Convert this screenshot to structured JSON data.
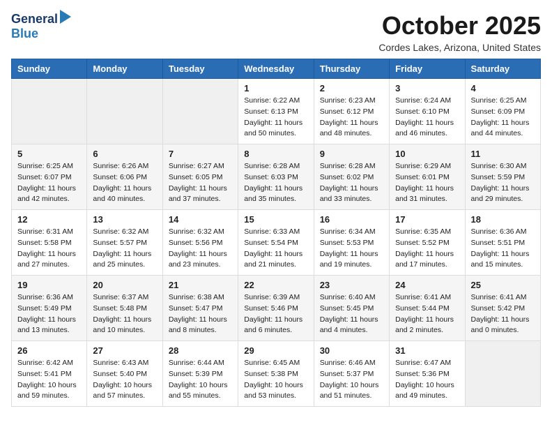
{
  "logo": {
    "line1": "General",
    "line2": "Blue"
  },
  "title": "October 2025",
  "subtitle": "Cordes Lakes, Arizona, United States",
  "weekdays": [
    "Sunday",
    "Monday",
    "Tuesday",
    "Wednesday",
    "Thursday",
    "Friday",
    "Saturday"
  ],
  "rows": [
    [
      {
        "day": "",
        "info": ""
      },
      {
        "day": "",
        "info": ""
      },
      {
        "day": "",
        "info": ""
      },
      {
        "day": "1",
        "info": "Sunrise: 6:22 AM\nSunset: 6:13 PM\nDaylight: 11 hours\nand 50 minutes."
      },
      {
        "day": "2",
        "info": "Sunrise: 6:23 AM\nSunset: 6:12 PM\nDaylight: 11 hours\nand 48 minutes."
      },
      {
        "day": "3",
        "info": "Sunrise: 6:24 AM\nSunset: 6:10 PM\nDaylight: 11 hours\nand 46 minutes."
      },
      {
        "day": "4",
        "info": "Sunrise: 6:25 AM\nSunset: 6:09 PM\nDaylight: 11 hours\nand 44 minutes."
      }
    ],
    [
      {
        "day": "5",
        "info": "Sunrise: 6:25 AM\nSunset: 6:07 PM\nDaylight: 11 hours\nand 42 minutes."
      },
      {
        "day": "6",
        "info": "Sunrise: 6:26 AM\nSunset: 6:06 PM\nDaylight: 11 hours\nand 40 minutes."
      },
      {
        "day": "7",
        "info": "Sunrise: 6:27 AM\nSunset: 6:05 PM\nDaylight: 11 hours\nand 37 minutes."
      },
      {
        "day": "8",
        "info": "Sunrise: 6:28 AM\nSunset: 6:03 PM\nDaylight: 11 hours\nand 35 minutes."
      },
      {
        "day": "9",
        "info": "Sunrise: 6:28 AM\nSunset: 6:02 PM\nDaylight: 11 hours\nand 33 minutes."
      },
      {
        "day": "10",
        "info": "Sunrise: 6:29 AM\nSunset: 6:01 PM\nDaylight: 11 hours\nand 31 minutes."
      },
      {
        "day": "11",
        "info": "Sunrise: 6:30 AM\nSunset: 5:59 PM\nDaylight: 11 hours\nand 29 minutes."
      }
    ],
    [
      {
        "day": "12",
        "info": "Sunrise: 6:31 AM\nSunset: 5:58 PM\nDaylight: 11 hours\nand 27 minutes."
      },
      {
        "day": "13",
        "info": "Sunrise: 6:32 AM\nSunset: 5:57 PM\nDaylight: 11 hours\nand 25 minutes."
      },
      {
        "day": "14",
        "info": "Sunrise: 6:32 AM\nSunset: 5:56 PM\nDaylight: 11 hours\nand 23 minutes."
      },
      {
        "day": "15",
        "info": "Sunrise: 6:33 AM\nSunset: 5:54 PM\nDaylight: 11 hours\nand 21 minutes."
      },
      {
        "day": "16",
        "info": "Sunrise: 6:34 AM\nSunset: 5:53 PM\nDaylight: 11 hours\nand 19 minutes."
      },
      {
        "day": "17",
        "info": "Sunrise: 6:35 AM\nSunset: 5:52 PM\nDaylight: 11 hours\nand 17 minutes."
      },
      {
        "day": "18",
        "info": "Sunrise: 6:36 AM\nSunset: 5:51 PM\nDaylight: 11 hours\nand 15 minutes."
      }
    ],
    [
      {
        "day": "19",
        "info": "Sunrise: 6:36 AM\nSunset: 5:49 PM\nDaylight: 11 hours\nand 13 minutes."
      },
      {
        "day": "20",
        "info": "Sunrise: 6:37 AM\nSunset: 5:48 PM\nDaylight: 11 hours\nand 10 minutes."
      },
      {
        "day": "21",
        "info": "Sunrise: 6:38 AM\nSunset: 5:47 PM\nDaylight: 11 hours\nand 8 minutes."
      },
      {
        "day": "22",
        "info": "Sunrise: 6:39 AM\nSunset: 5:46 PM\nDaylight: 11 hours\nand 6 minutes."
      },
      {
        "day": "23",
        "info": "Sunrise: 6:40 AM\nSunset: 5:45 PM\nDaylight: 11 hours\nand 4 minutes."
      },
      {
        "day": "24",
        "info": "Sunrise: 6:41 AM\nSunset: 5:44 PM\nDaylight: 11 hours\nand 2 minutes."
      },
      {
        "day": "25",
        "info": "Sunrise: 6:41 AM\nSunset: 5:42 PM\nDaylight: 11 hours\nand 0 minutes."
      }
    ],
    [
      {
        "day": "26",
        "info": "Sunrise: 6:42 AM\nSunset: 5:41 PM\nDaylight: 10 hours\nand 59 minutes."
      },
      {
        "day": "27",
        "info": "Sunrise: 6:43 AM\nSunset: 5:40 PM\nDaylight: 10 hours\nand 57 minutes."
      },
      {
        "day": "28",
        "info": "Sunrise: 6:44 AM\nSunset: 5:39 PM\nDaylight: 10 hours\nand 55 minutes."
      },
      {
        "day": "29",
        "info": "Sunrise: 6:45 AM\nSunset: 5:38 PM\nDaylight: 10 hours\nand 53 minutes."
      },
      {
        "day": "30",
        "info": "Sunrise: 6:46 AM\nSunset: 5:37 PM\nDaylight: 10 hours\nand 51 minutes."
      },
      {
        "day": "31",
        "info": "Sunrise: 6:47 AM\nSunset: 5:36 PM\nDaylight: 10 hours\nand 49 minutes."
      },
      {
        "day": "",
        "info": ""
      }
    ]
  ]
}
